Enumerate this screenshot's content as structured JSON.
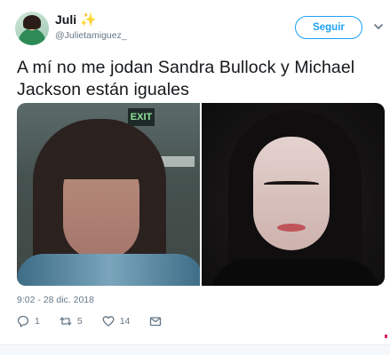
{
  "author": {
    "display_name": "Juli",
    "emoji": "✨",
    "handle": "@Julietamiguez_"
  },
  "follow_button": {
    "label": "Seguir"
  },
  "tweet": {
    "text": "A mí no me jodan Sandra Bullock y Michael Jackson están iguales",
    "timestamp": "9:02 - 28 dic. 2018"
  },
  "actions": {
    "replies": "1",
    "retweets": "5",
    "likes": "14"
  },
  "icons": {
    "reply": "reply-icon",
    "retweet": "retweet-icon",
    "like": "heart-icon",
    "dm": "envelope-icon",
    "caret": "chevron-down-icon"
  },
  "colors": {
    "accent": "#1da1f2",
    "muted": "#657786",
    "text": "#14171a"
  }
}
